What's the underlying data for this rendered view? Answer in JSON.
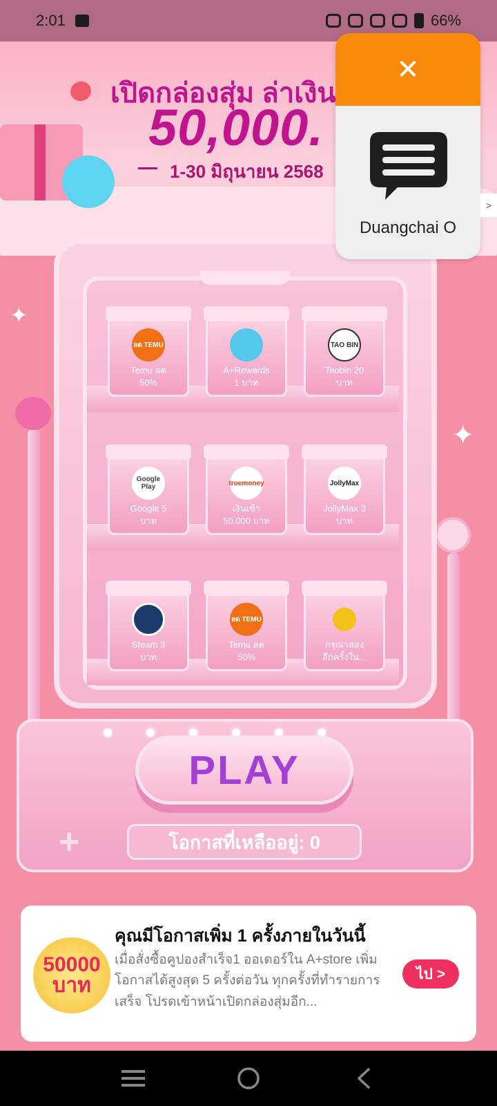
{
  "status_bar": {
    "time": "2:01",
    "battery": "66%"
  },
  "banner": {
    "headline": "เปิดกล่องสุ่ม ล่าเงินร",
    "amount": "50,000.",
    "dates": "1-30 มิถุนายน 2568"
  },
  "boxes": [
    {
      "logo_text": "ลด\nTEMU",
      "label": "Temu ลด\n50%",
      "logo_icon": "temu-logo-icon"
    },
    {
      "logo_text": "",
      "label": "A+Rewards\n1 บาท",
      "logo_icon": "a-plus-mascot-icon"
    },
    {
      "logo_text": "TAO BIN",
      "label": "Taobin 20\nบาท",
      "logo_icon": "taobin-logo-icon"
    },
    {
      "logo_text": "Google Play",
      "label": "Google 5\nบาท",
      "logo_icon": "google-play-icon"
    },
    {
      "logo_text": "truemoney",
      "label": "เงินเข้า\n50,000 บาท",
      "logo_icon": "truemoney-icon"
    },
    {
      "logo_text": "JollyMax",
      "label": "JollyMax 3\nบาท",
      "logo_icon": "jollymax-icon"
    },
    {
      "logo_text": "",
      "label": "Steam 3\nบาท",
      "logo_icon": "steam-icon"
    },
    {
      "logo_text": "ลด\nTEMU",
      "label": "Temu ลด\n50%",
      "logo_icon": "temu-logo-icon"
    },
    {
      "logo_text": "",
      "label": "กรุณาลอง\nอีกครั้งใน...",
      "logo_icon": "smiley-icon"
    }
  ],
  "machine": {
    "play_label": "PLAY",
    "chances_label": "โอกาสที่เหลืออยู่: 0"
  },
  "info_card": {
    "coin_line1": "50000",
    "coin_line2": "บาท",
    "title": "คุณมีโอกาสเพิ่ม 1 ครั้งภายในวันนี้",
    "body": "เมื่อสั่งซื้อคูปองสำเร็จ1 ออเดอร์ใน A+store เพิ่มโอกาสได้สูงสุด 5 ครั้งต่อวัน ทุกครั้งที่ทำรายการเสร็จ โปรดเข้าหน้าเปิดกล่องสุ่มอีก...",
    "go_label": "ไป >"
  },
  "chat_bubble": {
    "name": "Duangchai O",
    "close_symbol": "✕"
  },
  "side_arrow": ">",
  "colors": {
    "accent_orange": "#fa8a0c",
    "brand_pink": "#c0148e",
    "go_red": "#ef2f5e",
    "play_purple": "#a43fd6"
  }
}
